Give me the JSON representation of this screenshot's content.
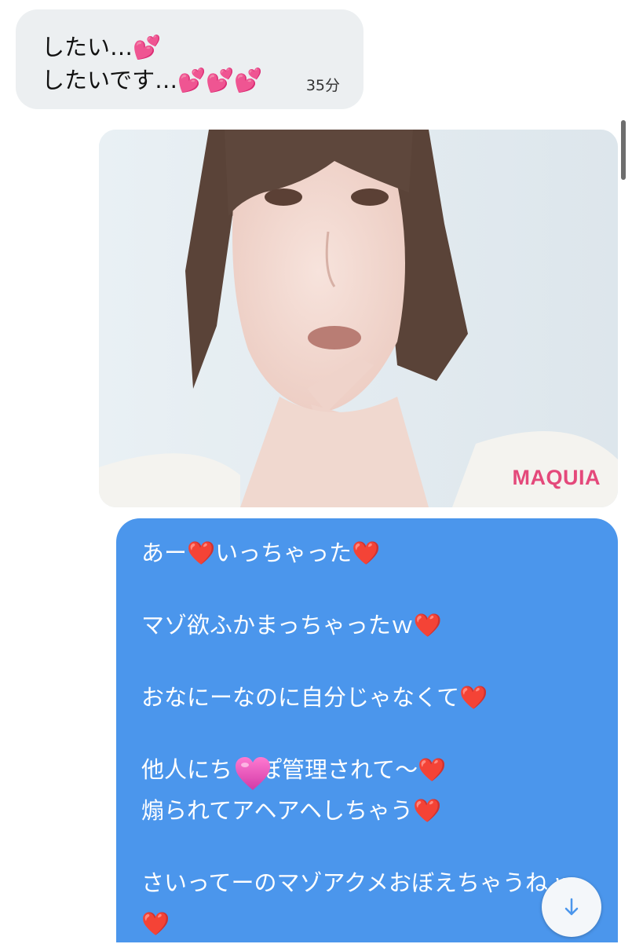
{
  "incoming_message": {
    "line1": "したい…💕",
    "line2": "したいです…💕💕💕",
    "time": "35分"
  },
  "photo": {
    "watermark": "MAQUIA"
  },
  "outgoing_message": {
    "lines": [
      "あー❤️いっちゃった❤️",
      "マゾ欲ふかまっちゃったｗ❤️",
      "おなにーなのに自分じゃなくて❤️",
      "他人にち",
      "ぽ管理されて〜❤️",
      "煽られてアヘアヘしちゃう❤️",
      "さいってーのマゾアクメおぼえちゃうね w",
      "❤️"
    ]
  },
  "icons": {
    "sticker": "heart-sticker-icon",
    "scroll_down": "arrow-down-icon"
  },
  "colors": {
    "incoming_bubble": "#eceff1",
    "outgoing_bubble": "#4b96ec",
    "watermark": "#e4497b"
  }
}
